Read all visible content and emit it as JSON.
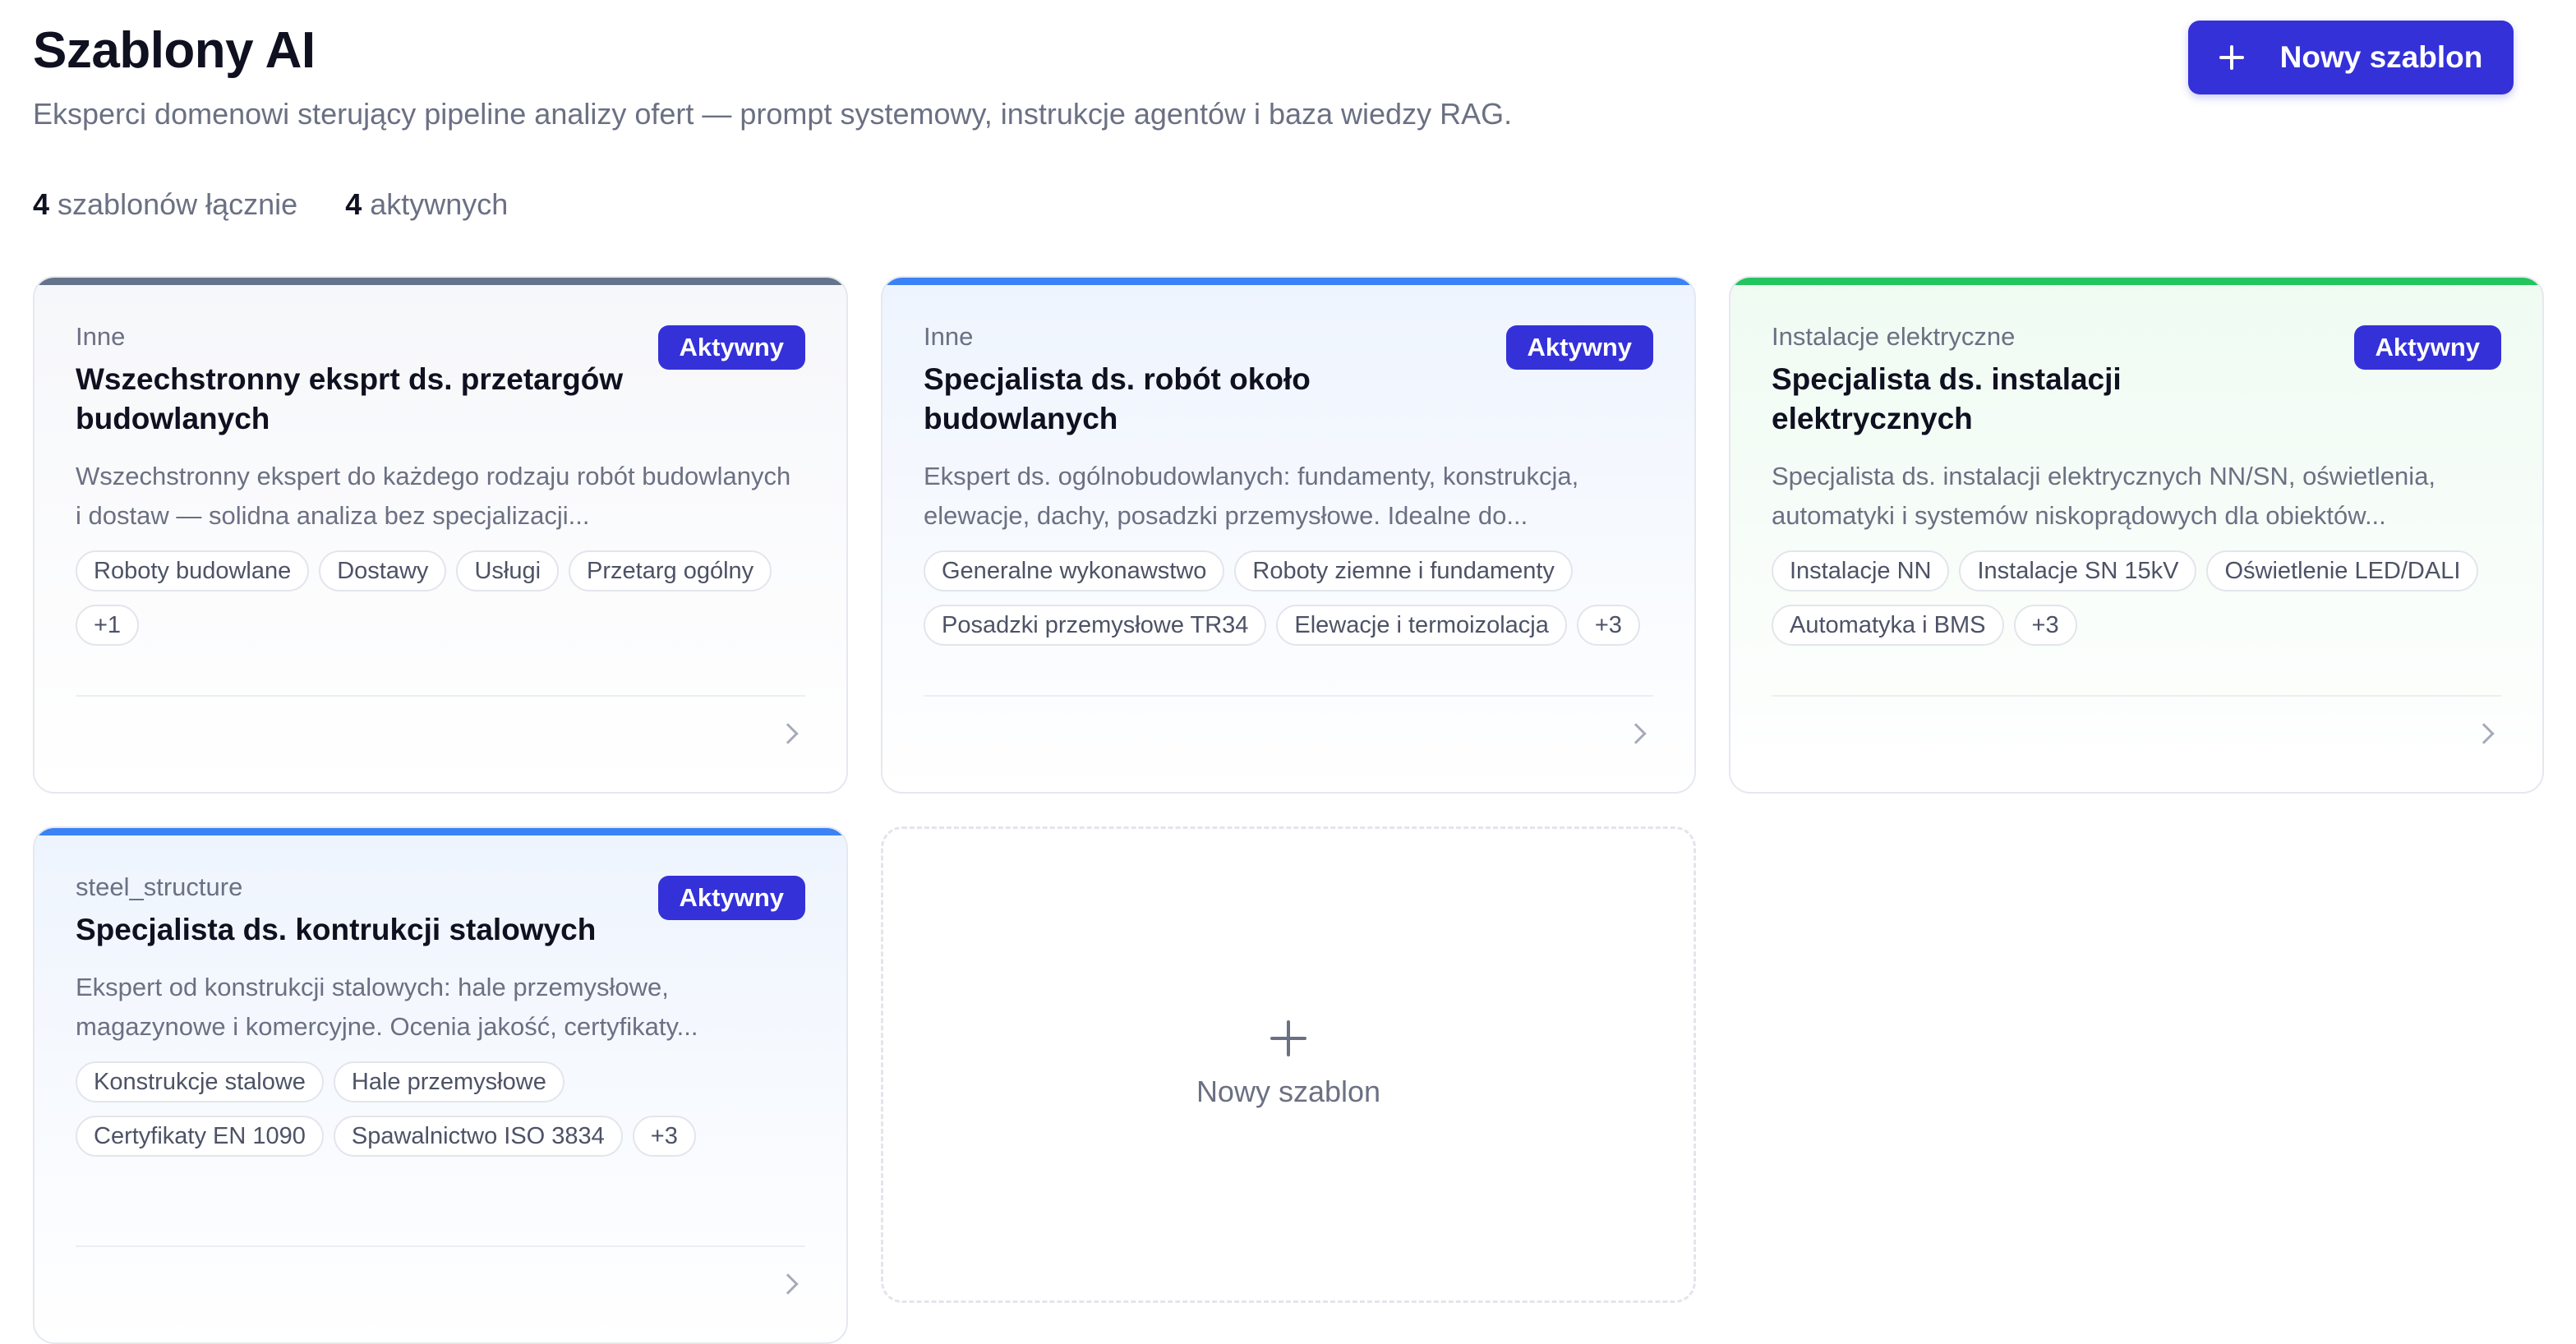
{
  "header": {
    "title": "Szablony AI",
    "subtitle": "Eksperci domenowi sterujący pipeline analizy ofert — prompt systemowy, instrukcje agentów i baza wiedzy RAG.",
    "new_button_label": "Nowy szablon"
  },
  "stats": {
    "total_count": "4",
    "total_label": "szablonów łącznie",
    "active_count": "4",
    "active_label": "aktywnych"
  },
  "templates": [
    {
      "category": "Inne",
      "name": "Wszechstronny eksprt ds. przetargów budowlanych",
      "description": "Wszechstronny ekspert do każdego rodzaju robót budowlanych i dostaw — solidna analiza bez specjalizacji...",
      "status": "Aktywny",
      "accent_color": "#64748b",
      "tags": [
        "Roboty budowlane",
        "Dostawy",
        "Usługi",
        "Przetarg ogólny",
        "+1"
      ]
    },
    {
      "category": "Inne",
      "name": "Specjalista ds. robót około budowlanych",
      "description": "Ekspert ds. ogólnobudowlanych: fundamenty, konstrukcja, elewacje, dachy, posadzki przemysłowe. Idealne do...",
      "status": "Aktywny",
      "accent_color": "#3b82f6",
      "tags": [
        "Generalne wykonawstwo",
        "Roboty ziemne i fundamenty",
        "Posadzki przemysłowe TR34",
        "Elewacje i termoizolacja",
        "+3"
      ]
    },
    {
      "category": "Instalacje elektryczne",
      "name": "Specjalista ds. instalacji elektrycznych",
      "description": "Specjalista ds. instalacji elektrycznych NN/SN, oświetlenia, automatyki i systemów niskoprądowych dla obiektów...",
      "status": "Aktywny",
      "accent_color": "#22c55e",
      "tags": [
        "Instalacje NN",
        "Instalacje SN 15kV",
        "Oświetlenie LED/DALI",
        "Automatyka i BMS",
        "+3"
      ]
    },
    {
      "category": "steel_structure",
      "name": "Specjalista ds. kontrukcji stalowych",
      "description": "Ekspert od konstrukcji stalowych: hale przemysłowe, magazynowe i komercyjne. Ocenia jakość, certyfikaty...",
      "status": "Aktywny",
      "accent_color": "#3b82f6",
      "tags": [
        "Konstrukcje stalowe",
        "Hale przemysłowe",
        "Certyfikaty EN 1090",
        "Spawalnictwo ISO 3834",
        "+3"
      ]
    }
  ],
  "add_card": {
    "label": "Nowy szablon"
  }
}
